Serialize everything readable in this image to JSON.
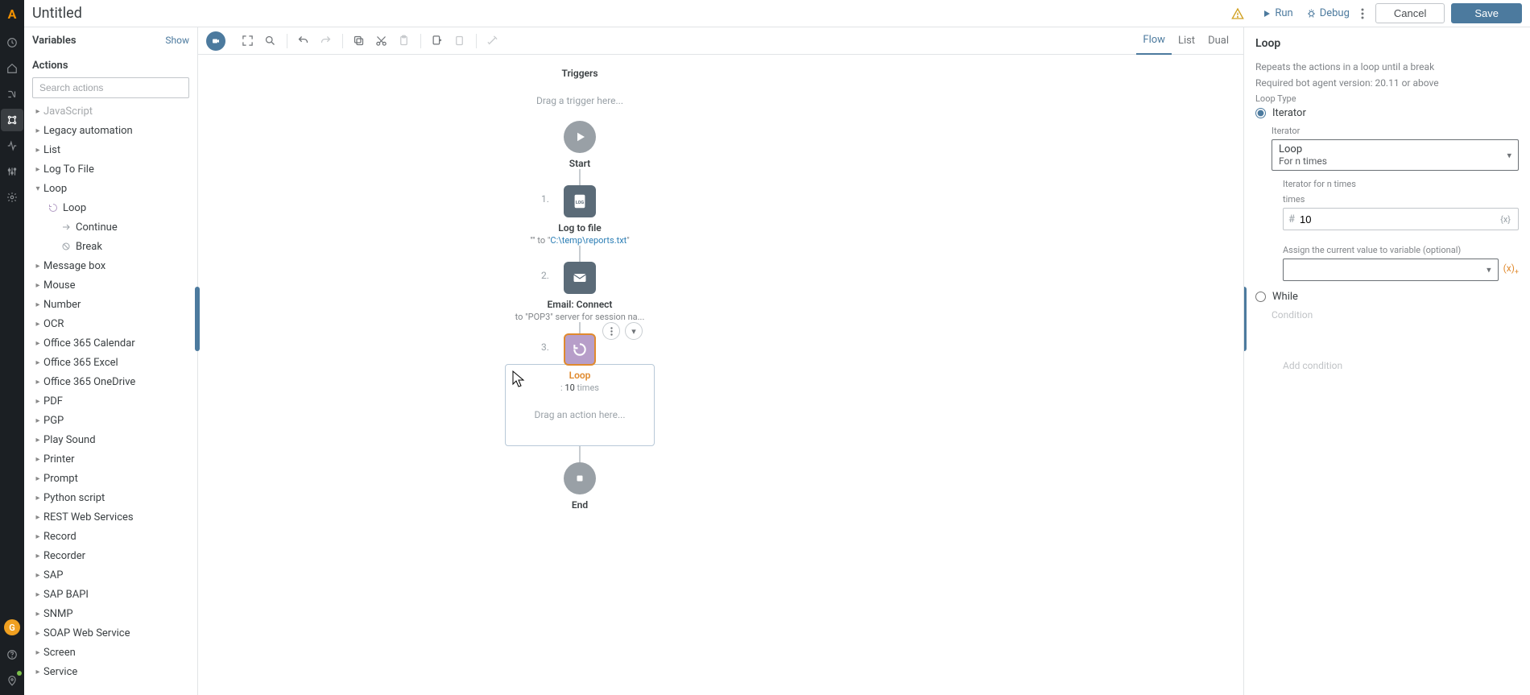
{
  "title": "Untitled",
  "header": {
    "run": "Run",
    "debug": "Debug",
    "cancel": "Cancel",
    "save": "Save"
  },
  "rail": {
    "avatar": "G"
  },
  "panelLeft": {
    "variablesTitle": "Variables",
    "show": "Show",
    "actionsTitle": "Actions",
    "searchPlaceholder": "Search actions",
    "nodes": {
      "javascript": "JavaScript",
      "legacy": "Legacy automation",
      "list": "List",
      "logtofile": "Log To File",
      "loop": "Loop",
      "loop_child_loop": "Loop",
      "loop_child_continue": "Continue",
      "loop_child_break": "Break",
      "messagebox": "Message box",
      "mouse": "Mouse",
      "number": "Number",
      "ocr": "OCR",
      "o365cal": "Office 365 Calendar",
      "o365excel": "Office 365 Excel",
      "o365od": "Office 365 OneDrive",
      "pdf": "PDF",
      "pgp": "PGP",
      "playsound": "Play Sound",
      "printer": "Printer",
      "prompt": "Prompt",
      "python": "Python script",
      "rest": "REST Web Services",
      "record": "Record",
      "recorder": "Recorder",
      "sap": "SAP",
      "sapbapi": "SAP BAPI",
      "snmp": "SNMP",
      "soap": "SOAP Web Service",
      "screen": "Screen",
      "service": "Service"
    }
  },
  "toolbar": {
    "tabs": {
      "flow": "Flow",
      "list": "List",
      "dual": "Dual"
    }
  },
  "flow": {
    "triggersHeader": "Triggers",
    "triggerDrop": "Drag a trigger here...",
    "start": "Start",
    "end": "End",
    "step1": {
      "title": "Log to file",
      "pre": "\"\" to \"",
      "path": "C:\\temp\\reports.txt",
      "post": "\""
    },
    "step2": {
      "title": "Email: Connect",
      "caption": "to \"POP3\" server for session na..."
    },
    "step3": {
      "title": "Loop",
      "count": "10",
      "countSuffix": " times",
      "drop": "Drag an action here..."
    },
    "n1": "1.",
    "n2": "2.",
    "n3": "3."
  },
  "props": {
    "title": "Loop",
    "desc": "Repeats the actions in a loop until a break",
    "req": "Required bot agent version: 20.11 or above",
    "loopType": "Loop Type",
    "iterator": "Iterator",
    "iteratorLbl": "Iterator",
    "selectLine1": "Loop",
    "selectLine2": "For n times",
    "iterForN": "Iterator for n times",
    "times": "times",
    "timesVal": "10",
    "assign": "Assign the current value to variable (optional)",
    "while": "While",
    "condition": "Condition",
    "addCond": "Add condition"
  }
}
